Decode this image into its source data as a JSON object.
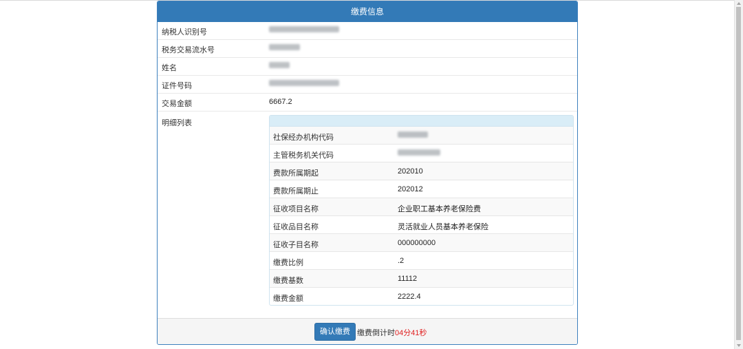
{
  "panel": {
    "title": "缴费信息"
  },
  "fields": {
    "taxpayer_id_label": "纳税人识别号",
    "tax_txn_serial_label": "税务交易流水号",
    "name_label": "姓名",
    "id_number_label": "证件号码",
    "amount_label": "交易金额",
    "amount_value": "6667.2",
    "detail_label": "明细列表"
  },
  "detail_rows": [
    {
      "label": "社保经办机构代码",
      "value": ""
    },
    {
      "label": "主管税务机关代码",
      "value": ""
    },
    {
      "label": "费款所属期起",
      "value": "202010"
    },
    {
      "label": "费款所属期止",
      "value": "202012"
    },
    {
      "label": "征收项目名称",
      "value": "企业职工基本养老保险费"
    },
    {
      "label": "征收品目名称",
      "value": "灵活就业人员基本养老保险"
    },
    {
      "label": "征收子目名称",
      "value": "000000000"
    },
    {
      "label": "缴费比例",
      "value": ".2"
    },
    {
      "label": "缴费基数",
      "value": "11112"
    },
    {
      "label": "缴费金额",
      "value": "2222.4"
    }
  ],
  "footer": {
    "confirm_label": "确认缴费",
    "countdown_prefix": "缴费倒计时",
    "minutes": "04",
    "minutes_unit": "分",
    "seconds": "41",
    "seconds_unit": "秒"
  },
  "colors": {
    "primary": "#337ab7",
    "info_head": "#d9edf7",
    "countdown_red": "#e02020"
  }
}
